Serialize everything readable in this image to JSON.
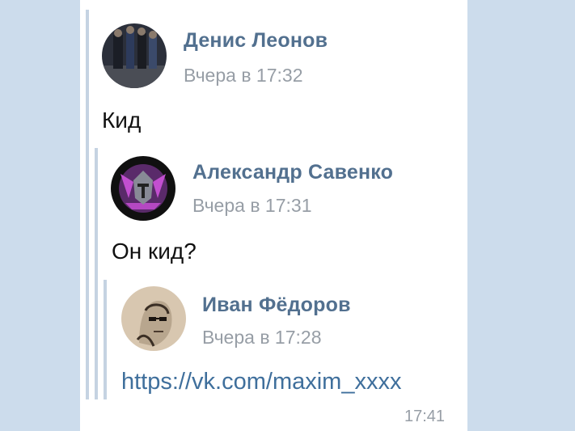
{
  "quotes": [
    {
      "author": "Денис Леонов",
      "time": "Вчера в 17:32",
      "text": "Кид",
      "avatar": "group-photo-avatar"
    },
    {
      "author": "Александр Савенко",
      "time": "Вчера в 17:31",
      "text": "Он кид?",
      "avatar": "knight-helmet-emblem-avatar"
    },
    {
      "author": "Иван Фёдоров",
      "time": "Вчера в 17:28",
      "link": "https://vk.com/maxim_xxxx",
      "avatar": "sketch-portrait-avatar"
    }
  ],
  "message_time": "17:41",
  "colors": {
    "background": "#ccdcec",
    "author_name": "#52708f",
    "link": "#3f6f9c",
    "quote_bar": "#c5d3e2",
    "muted": "#979ea6"
  }
}
